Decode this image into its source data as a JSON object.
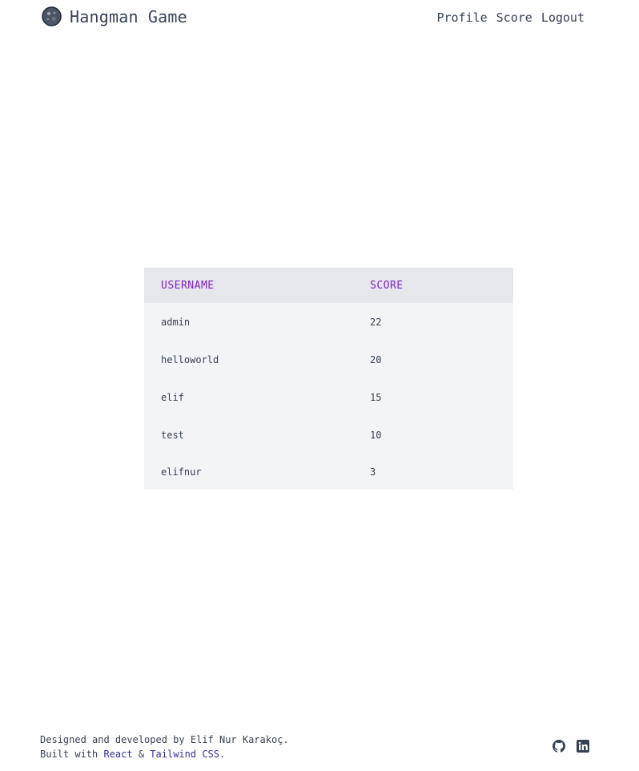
{
  "header": {
    "title": "Hangman Game",
    "logo_icon": "planet-ball-icon",
    "nav": [
      "Profile",
      "Score",
      "Logout"
    ]
  },
  "table": {
    "headers": [
      "USERNAME",
      "SCORE"
    ],
    "rows": [
      {
        "username": "admin",
        "score": "22"
      },
      {
        "username": "helloworld",
        "score": "20"
      },
      {
        "username": "elif",
        "score": "15"
      },
      {
        "username": "test",
        "score": "10"
      },
      {
        "username": "elifnur",
        "score": "3"
      }
    ]
  },
  "footer": {
    "line1": "Designed and developed by Elif Nur Karakoç.",
    "built_prefix": "Built with ",
    "react_link": "React",
    "amp": " & ",
    "tailwind_link": "Tailwind CSS",
    "period": ".",
    "social_icons": [
      "github-icon",
      "linkedin-icon"
    ]
  },
  "colors": {
    "header_text": "#374151",
    "table_header_bg": "#e5e7eb",
    "table_body_bg": "#f3f4f6",
    "table_header_text": "#7e22ce",
    "link": "#3730a3"
  }
}
